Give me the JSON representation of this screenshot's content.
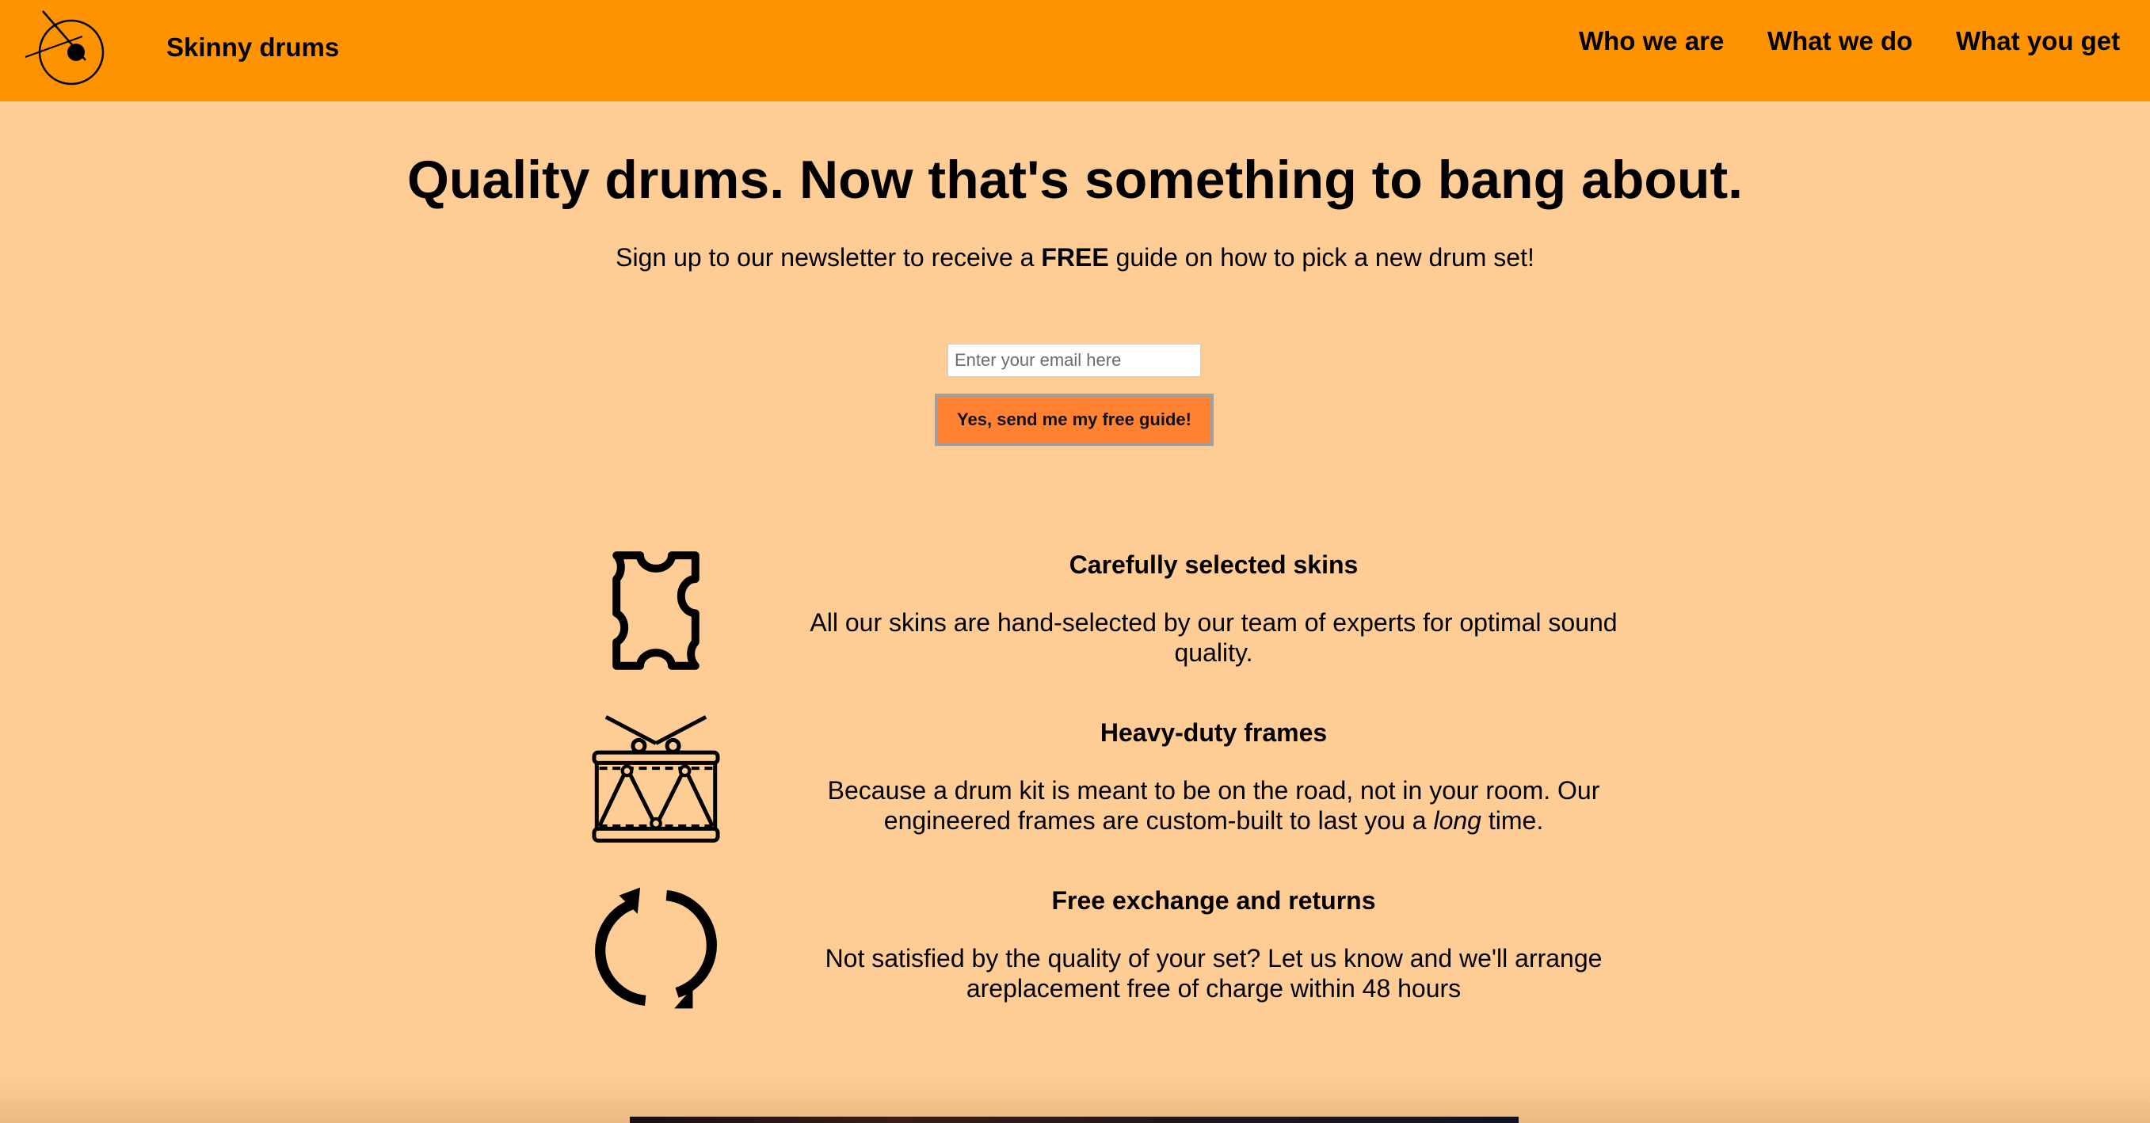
{
  "header": {
    "brand": "Skinny drums",
    "nav": [
      "Who we are",
      "What we do",
      "What you get"
    ],
    "background_color": "#fe9302"
  },
  "hero": {
    "title": "Quality drums. Now that's something to bang about.",
    "subtitle_before": "Sign up to our newsletter to receive a ",
    "subtitle_bold": "FREE",
    "subtitle_after": " guide on how to pick a new drum set!"
  },
  "signup": {
    "email_placeholder": "Enter your email here",
    "email_value": "",
    "button_label": "Yes, send me my free guide!",
    "button_color": "#ff8232"
  },
  "features": [
    {
      "icon": "leather-skin-icon",
      "title": "Carefully selected skins",
      "text": "All our skins are hand-selected by our team of experts for optimal sound quality."
    },
    {
      "icon": "drum-icon",
      "title": "Heavy-duty frames",
      "text_before": "Because a drum kit is meant to be on the road, not in your room. Our engineered frames are custom-built to last you a ",
      "text_emphasis": "long",
      "text_after": " time."
    },
    {
      "icon": "exchange-arrows-icon",
      "title": "Free exchange and returns",
      "text": "Not satisfied by the quality of your set? Let us know and we'll arrange areplacement free of charge within 48 hours"
    }
  ],
  "colors": {
    "page_background": "#fecc95",
    "text": "#000000"
  }
}
